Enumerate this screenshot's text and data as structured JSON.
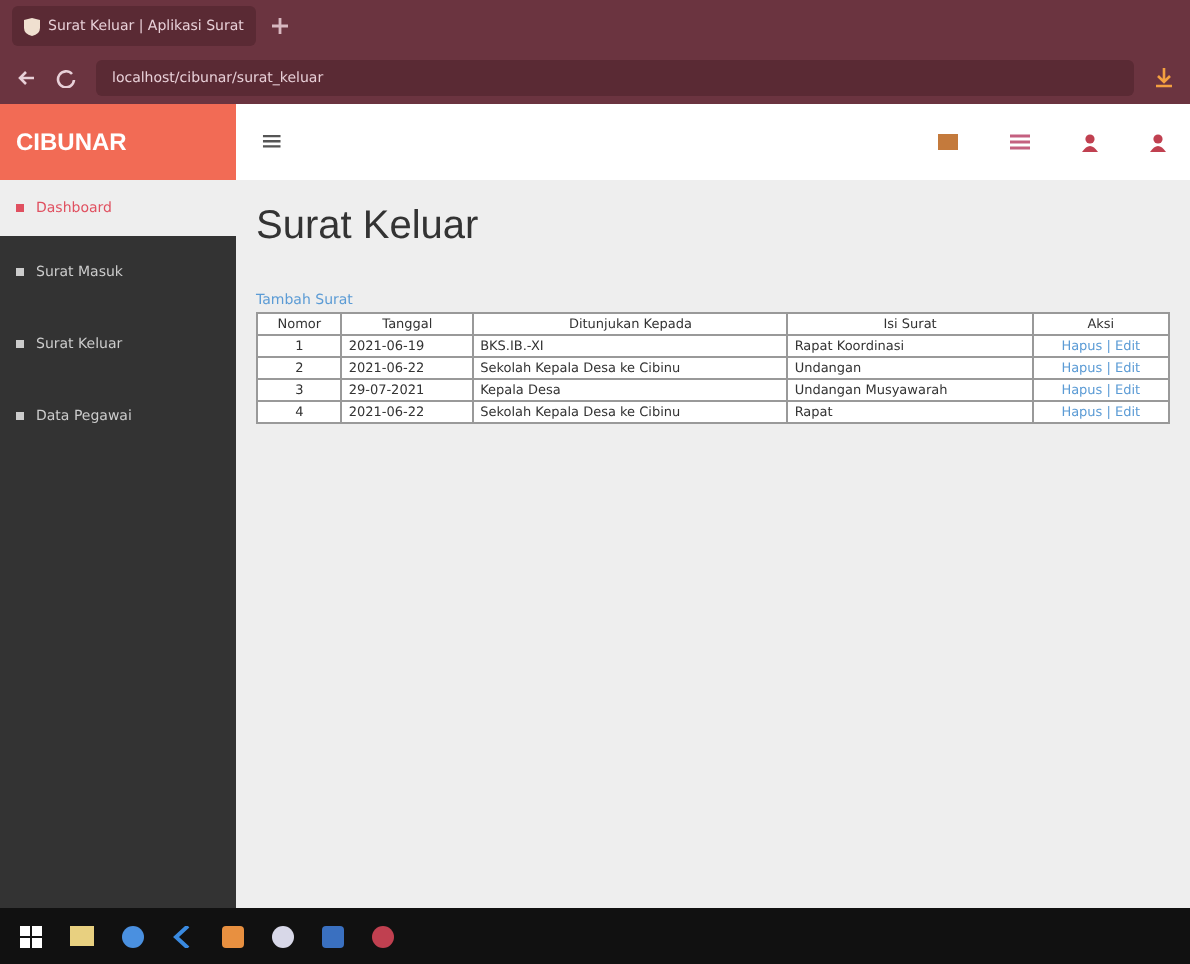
{
  "browser": {
    "tab_title": "Surat Keluar | Aplikasi Surat",
    "address": "localhost/cibunar/surat_keluar"
  },
  "app": {
    "brand": "CIBUNAR",
    "menu_icon": "≡"
  },
  "sidebar": {
    "items": [
      {
        "label": "Dashboard",
        "selected": true
      },
      {
        "label": "Surat Masuk",
        "selected": false
      },
      {
        "label": "Surat Keluar",
        "selected": false
      },
      {
        "label": "Data Pegawai",
        "selected": false
      }
    ]
  },
  "page": {
    "title": "Surat Keluar",
    "add_link": "Tambah Surat"
  },
  "table": {
    "columns": [
      "Nomor",
      "Tanggal",
      "Ditunjukan Kepada",
      "Isi Surat",
      "Aksi"
    ],
    "rows": [
      [
        "1",
        "2021-06-19",
        "BKS.IB.-XI",
        "Rapat Koordinasi",
        "Hapus | Edit"
      ],
      [
        "2",
        "2021-06-22",
        "Sekolah Kepala Desa ke Cibinu",
        "Undangan",
        "Hapus | Edit"
      ],
      [
        "3",
        "29-07-2021",
        "Kepala Desa",
        "Undangan Musyawarah",
        "Hapus | Edit"
      ],
      [
        "4",
        "2021-06-22",
        "Sekolah Kepala Desa ke Cibinu",
        "Rapat",
        "Hapus | Edit"
      ]
    ]
  }
}
